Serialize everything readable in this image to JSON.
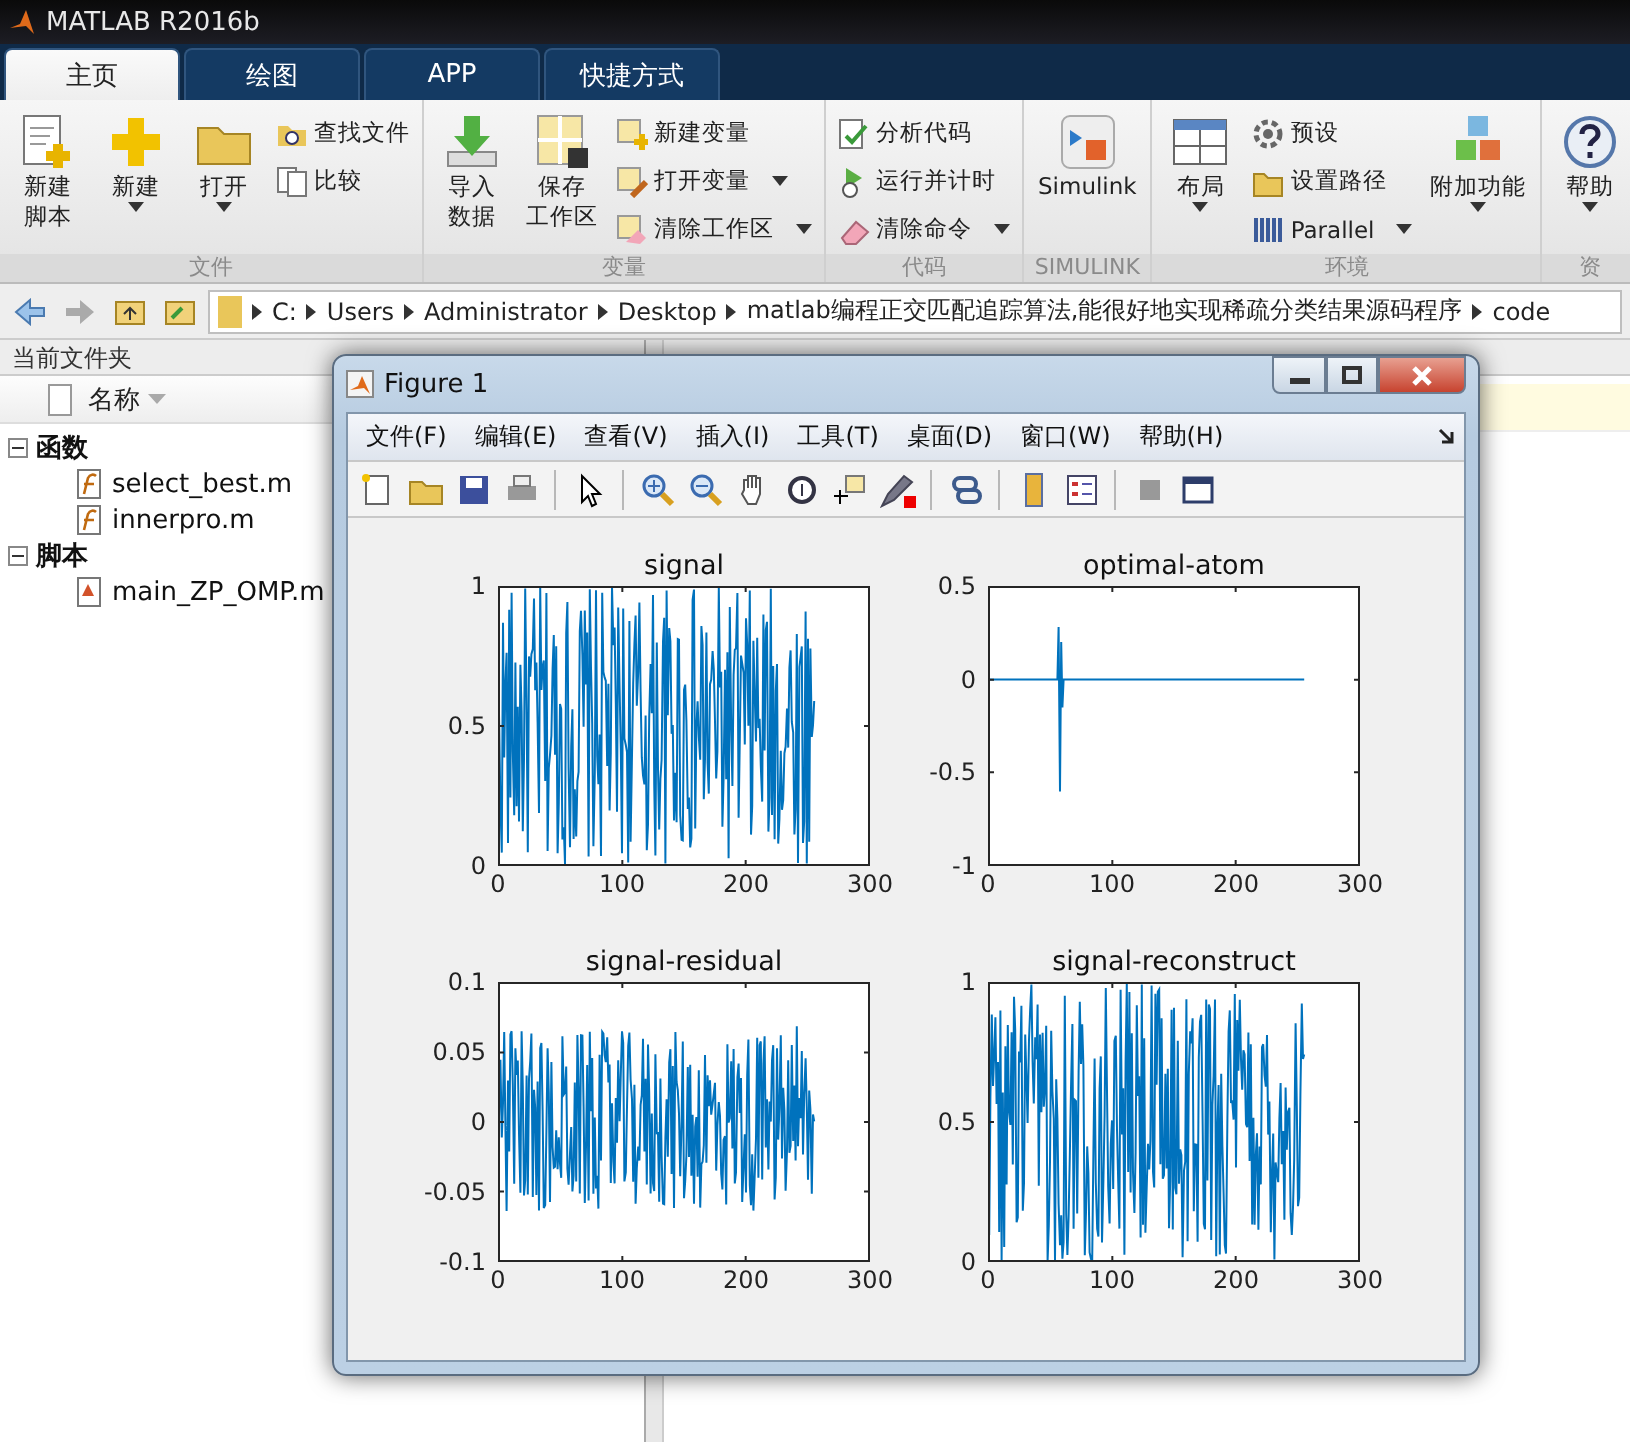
{
  "window": {
    "title": "MATLAB R2016b"
  },
  "tabs": [
    {
      "label": "主页",
      "selected": true
    },
    {
      "label": "绘图",
      "selected": false
    },
    {
      "label": "APP",
      "selected": false
    },
    {
      "label": "快捷方式",
      "selected": false
    }
  ],
  "ribbon": [
    {
      "label": "文件",
      "items": [
        {
          "kind": "large",
          "lines": [
            "新建",
            "脚本"
          ],
          "caret": false
        },
        {
          "kind": "large",
          "lines": [
            "新建"
          ],
          "caret": true
        },
        {
          "kind": "large",
          "lines": [
            "打开"
          ],
          "caret": true
        },
        {
          "kind": "stack",
          "items": [
            {
              "label": "查找文件",
              "caret": false
            },
            {
              "label": "比较",
              "caret": false
            }
          ]
        }
      ]
    },
    {
      "label": "变量",
      "items": [
        {
          "kind": "large",
          "lines": [
            "导入",
            "数据"
          ],
          "caret": false
        },
        {
          "kind": "large",
          "lines": [
            "保存",
            "工作区"
          ],
          "caret": false
        },
        {
          "kind": "stack",
          "items": [
            {
              "label": "新建变量",
              "caret": false
            },
            {
              "label": "打开变量",
              "caret": true
            },
            {
              "label": "清除工作区",
              "caret": true
            }
          ]
        }
      ]
    },
    {
      "label": "代码",
      "items": [
        {
          "kind": "stack",
          "items": [
            {
              "label": "分析代码",
              "caret": false
            },
            {
              "label": "运行并计时",
              "caret": false
            },
            {
              "label": "清除命令",
              "caret": true
            }
          ]
        }
      ]
    },
    {
      "label": "SIMULINK",
      "items": [
        {
          "kind": "large",
          "lines": [
            "Simulink"
          ],
          "caret": false
        }
      ]
    },
    {
      "label": "环境",
      "items": [
        {
          "kind": "large",
          "lines": [
            "布局"
          ],
          "caret": true
        },
        {
          "kind": "stack",
          "items": [
            {
              "label": "预设",
              "caret": false
            },
            {
              "label": "设置路径",
              "caret": false
            },
            {
              "label": "Parallel",
              "caret": true
            }
          ]
        },
        {
          "kind": "large",
          "lines": [
            "附加功能"
          ],
          "caret": true
        }
      ]
    },
    {
      "label": "资",
      "items": [
        {
          "kind": "large",
          "lines": [
            "帮助"
          ],
          "caret": true
        }
      ]
    }
  ],
  "address_bar": {
    "path": [
      "C:",
      "Users",
      "Administrator",
      "Desktop",
      "matlab编程正交匹配追踪算法,能很好地实现稀疏分类结果源码程序",
      "code"
    ]
  },
  "current_folder": {
    "title": "当前文件夹",
    "column": "名称",
    "tree": [
      {
        "label": "函数",
        "expanded": true,
        "children": [
          {
            "label": "select_best.m",
            "kind": "function"
          },
          {
            "label": "innerpro.m",
            "kind": "function"
          }
        ]
      },
      {
        "label": "脚本",
        "expanded": true,
        "children": [
          {
            "label": "main_ZP_OMP.m",
            "kind": "script"
          }
        ]
      }
    ]
  },
  "figure": {
    "title": "Figure 1",
    "menus": [
      "文件(F)",
      "编辑(E)",
      "查看(V)",
      "插入(I)",
      "工具(T)",
      "桌面(D)",
      "窗口(W)",
      "帮助(H)"
    ],
    "plots": [
      {
        "title": "signal",
        "kind": "uniform",
        "yticks": [
          "1",
          "0.5",
          "0"
        ],
        "xticks": [
          "0",
          "100",
          "200",
          "300"
        ]
      },
      {
        "title": "optimal-atom",
        "kind": "spike",
        "yticks": [
          "0.5",
          "0",
          "-0.5",
          "-1"
        ],
        "xticks": [
          "0",
          "100",
          "200",
          "300"
        ]
      },
      {
        "title": "signal-residual",
        "kind": "residual",
        "yticks": [
          "0.1",
          "0.05",
          "0",
          "-0.05",
          "-0.1"
        ],
        "xticks": [
          "0",
          "100",
          "200",
          "300"
        ]
      },
      {
        "title": "signal-reconstruct",
        "kind": "uniform",
        "yticks": [
          "1",
          "0.5",
          "0"
        ],
        "xticks": [
          "0",
          "100",
          "200",
          "300"
        ]
      }
    ]
  }
}
